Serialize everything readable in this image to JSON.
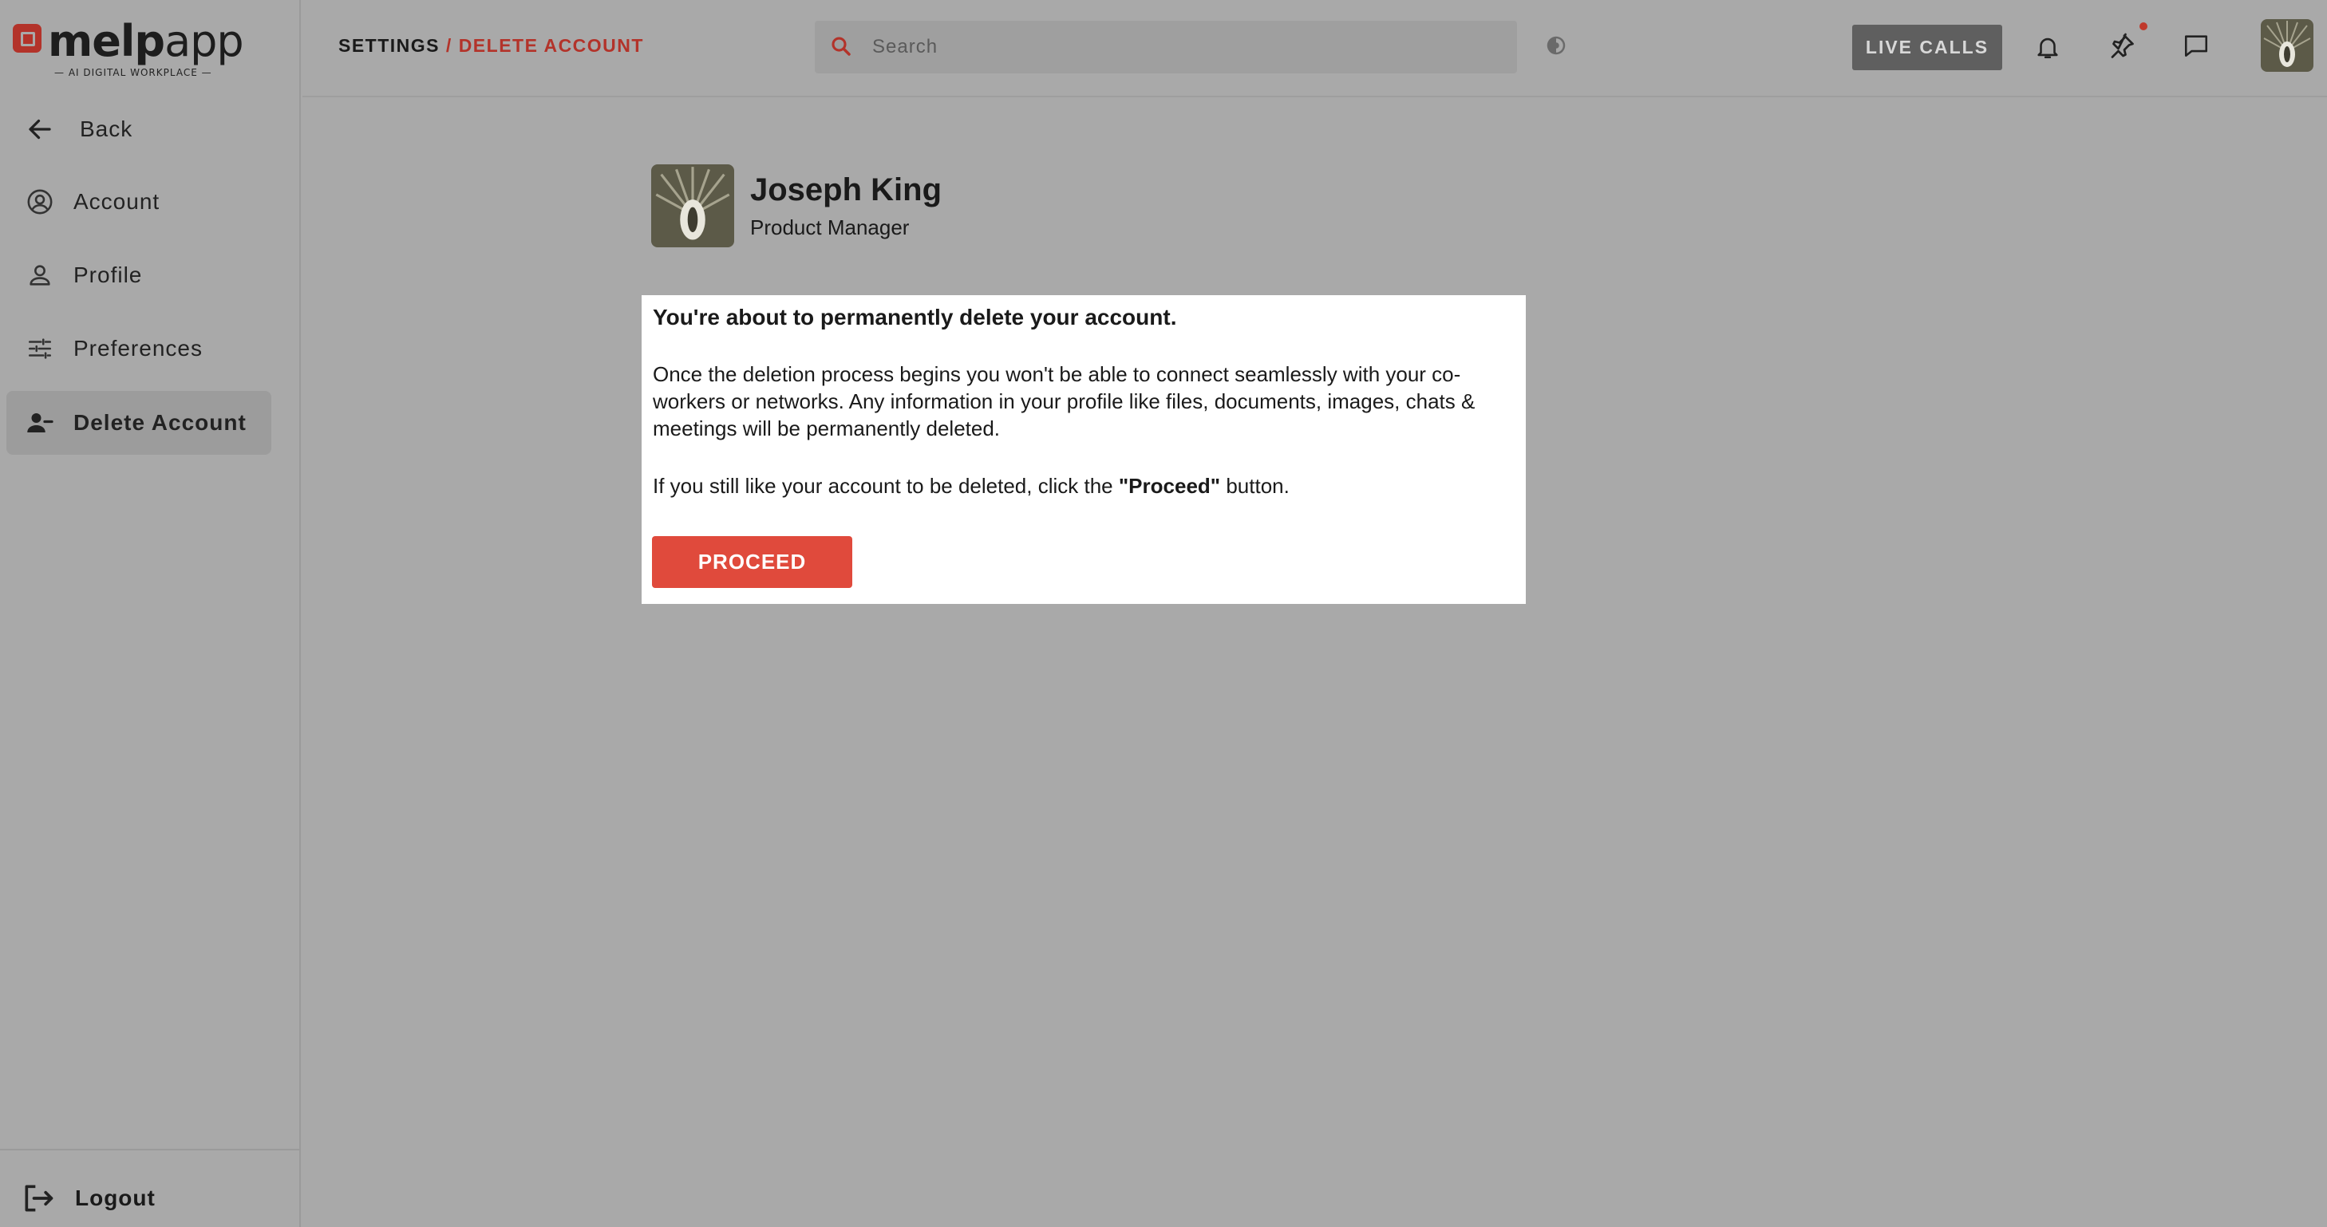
{
  "brand": {
    "name_bold": "melp",
    "name_light": "app",
    "tagline": "— AI DIGITAL WORKPLACE —",
    "accent": "#b3332a"
  },
  "sidebar": {
    "back_label": "Back",
    "items": [
      {
        "label": "Account",
        "icon": "account-circle-icon"
      },
      {
        "label": "Profile",
        "icon": "person-icon"
      },
      {
        "label": "Preferences",
        "icon": "sliders-icon"
      },
      {
        "label": "Delete Account",
        "icon": "person-remove-icon",
        "active": true
      }
    ],
    "logout_label": "Logout"
  },
  "header": {
    "breadcrumb_root": "SETTINGS",
    "breadcrumb_sep": " / ",
    "breadcrumb_current": "DELETE ACCOUNT",
    "search_placeholder": "Search",
    "live_calls_label": "LIVE CALLS",
    "notification_dot_color": "#c0392b"
  },
  "user": {
    "name": "Joseph King",
    "role": "Product Manager"
  },
  "delete_panel": {
    "title": "You're about to permanently delete your account.",
    "body": "Once the deletion process begins you won't be able to connect seamlessly with your co-workers or networks. Any information in your profile like files, documents, images, chats & meetings will be permanently deleted.",
    "note_prefix": "If you still like your account to be deleted, click the ",
    "note_emphasis": "\"Proceed\"",
    "note_suffix": " button.",
    "proceed_label": "PROCEED",
    "proceed_color": "#e04a3c"
  }
}
